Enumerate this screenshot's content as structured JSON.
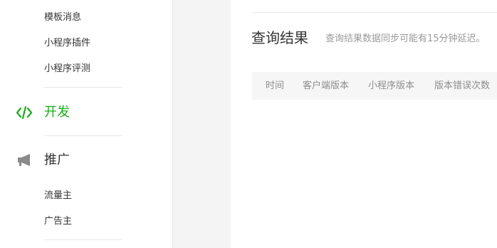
{
  "sidebar": {
    "manage_items": [
      "模板消息",
      "小程序插件",
      "小程序评测"
    ],
    "develop": {
      "label": "开发",
      "icon": "code-icon",
      "color": "#1aad19"
    },
    "promote": {
      "label": "推广",
      "icon": "megaphone-icon",
      "items": [
        "流量主",
        "广告主"
      ]
    }
  },
  "main": {
    "title": "查询结果",
    "description": "查询结果数据同步可能有15分钟延迟。",
    "table": {
      "columns": [
        "时间",
        "客户端版本",
        "小程序版本",
        "版本错误次数"
      ]
    }
  }
}
